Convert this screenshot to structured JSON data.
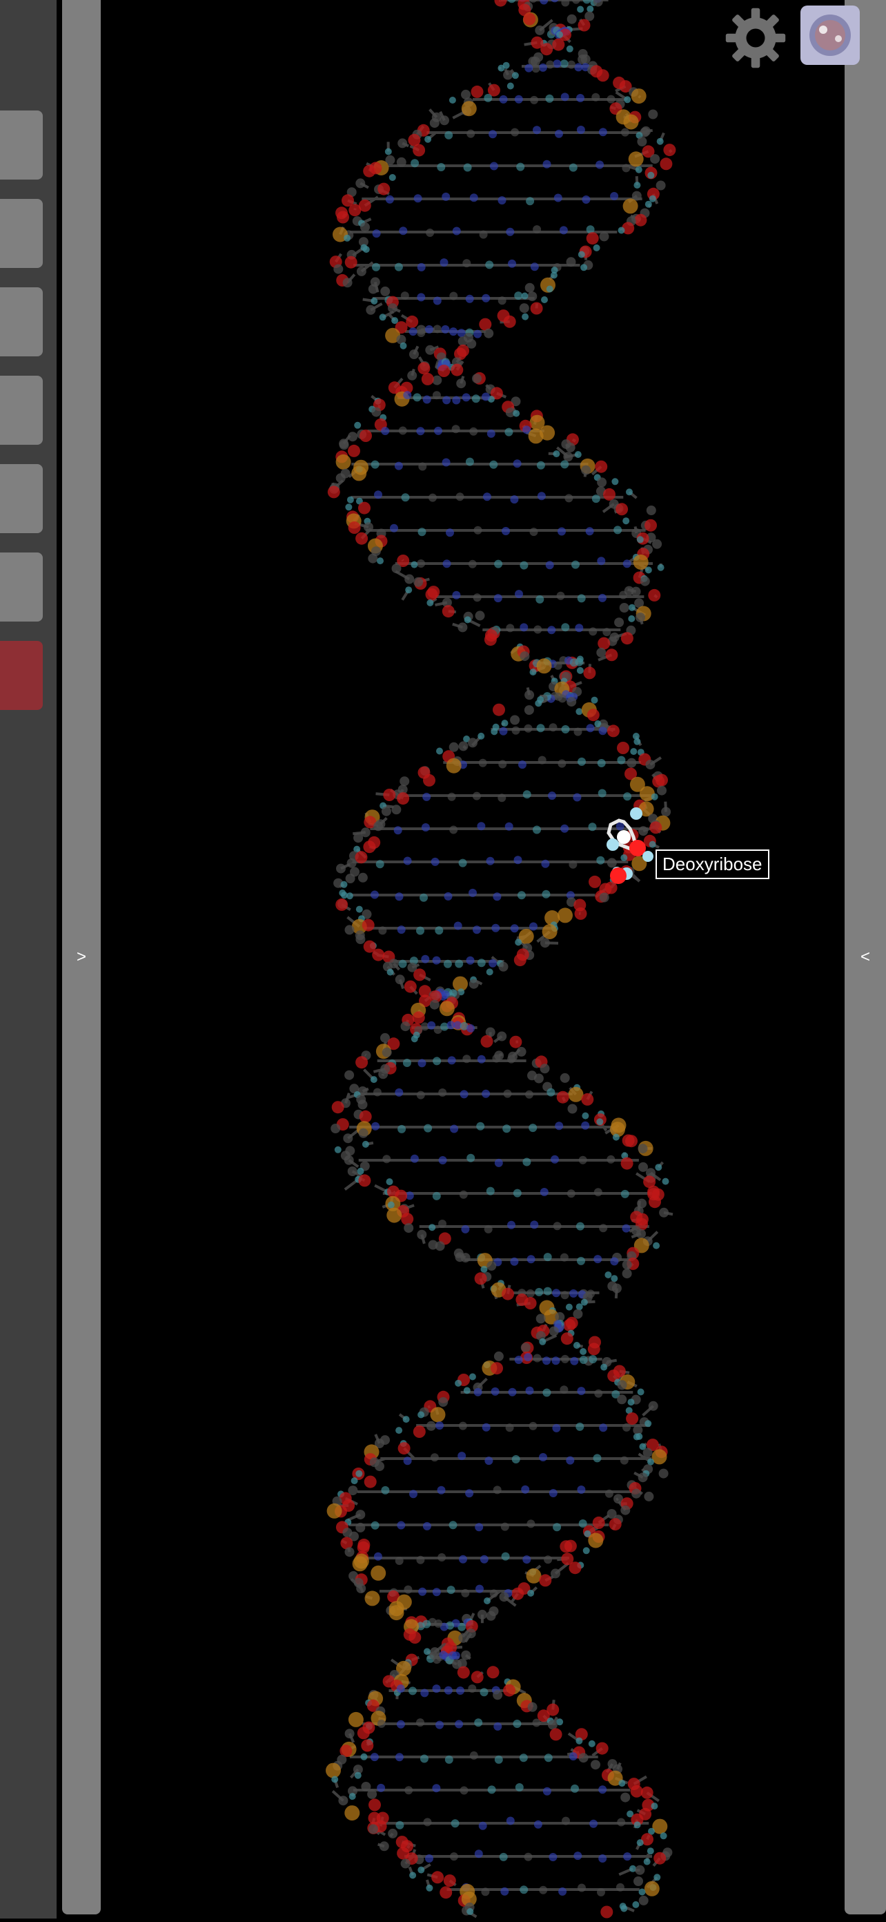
{
  "left_rail": {
    "buttons": [
      {
        "name": "tool-1",
        "accent": false
      },
      {
        "name": "tool-2",
        "accent": false
      },
      {
        "name": "tool-3",
        "accent": false
      },
      {
        "name": "tool-4",
        "accent": false
      },
      {
        "name": "tool-5",
        "accent": false
      },
      {
        "name": "tool-6",
        "accent": false
      },
      {
        "name": "tool-7",
        "accent": true
      }
    ]
  },
  "handles": {
    "left_label": ">",
    "right_label": "<"
  },
  "molecule": {
    "hover_label": "Deoxyribose"
  },
  "icons": {
    "settings": "gear-icon",
    "avatar": "molecule-avatar-icon"
  },
  "colors": {
    "background": "#000000",
    "rail": "#3f3f3f",
    "handle": "#7f7f7f",
    "button": "#808080",
    "accent_button": "#8e2f34",
    "oxygen": "#c01818",
    "carbon": "#4b4b4b",
    "nitrogen": "#2f3fb0",
    "phosphorus": "#b47818",
    "hydrogen": "#3f8a94"
  }
}
